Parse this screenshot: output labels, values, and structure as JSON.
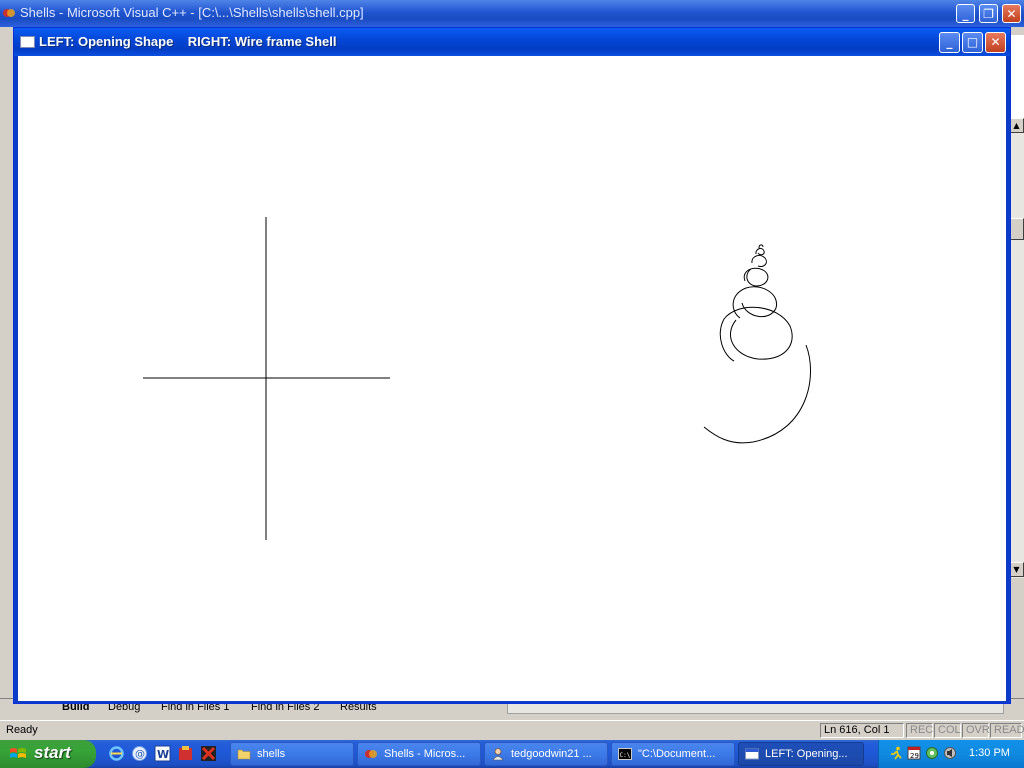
{
  "vc_window": {
    "title": "Shells - Microsoft Visual C++ - [C:\\...\\Shells\\shells\\shell.cpp]",
    "output_tabs": [
      "Build",
      "Debug",
      "Find in Files 1",
      "Find in Files 2",
      "Results"
    ],
    "status": {
      "text": "Ready",
      "position": "Ln 616, Col 1",
      "indicators": [
        "REC",
        "COL",
        "OVR",
        "READ"
      ]
    }
  },
  "gl_window": {
    "title": "LEFT: Opening Shape    RIGHT: Wire frame Shell"
  },
  "taskbar": {
    "start_label": "start",
    "buttons": [
      {
        "label": "shells",
        "icon": "folder-icon"
      },
      {
        "label": "Shells - Micros...",
        "icon": "visual-cpp-icon"
      },
      {
        "label": "tedgoodwin21 ...",
        "icon": "user-icon"
      },
      {
        "label": "\"C:\\Document...",
        "icon": "console-icon"
      },
      {
        "label": "LEFT: Opening...",
        "icon": "opengl-window-icon"
      }
    ],
    "tray": {
      "time": "1:30 PM",
      "icons": [
        "runner-icon",
        "calendar-icon",
        "network-icon",
        "speaker-icon"
      ]
    }
  },
  "colors": {
    "xp_blue": "#0a3cc8",
    "start_green": "#37a437",
    "tray_blue": "#0f8ae0",
    "canvas_bg": "#ffffff",
    "line_color": "#000000"
  }
}
